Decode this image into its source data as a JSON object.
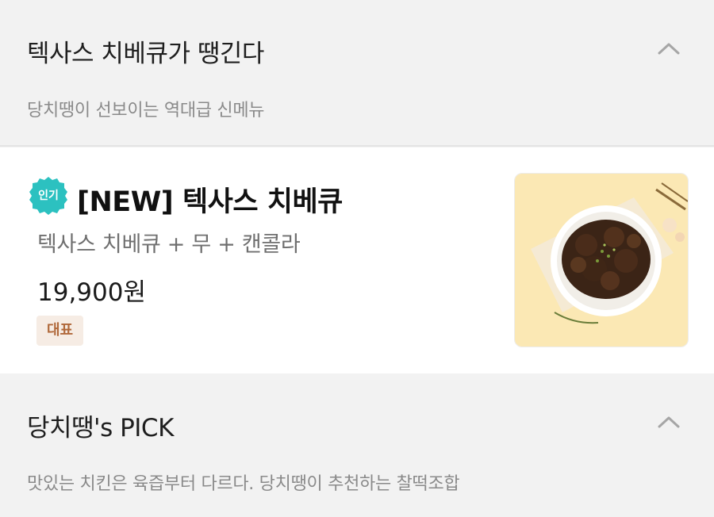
{
  "section1": {
    "title": "텍사스 치베큐가 땡긴다",
    "subtitle": "당치땡이 선보이는 역대급 신메뉴",
    "toggle_icon": "chevron-up-icon"
  },
  "menu_item": {
    "badge_label": "인기",
    "badge_color": "#2cc1c0",
    "name": "[NEW] 텍사스 치베큐",
    "description": "텍사스 치베큐 + 무 + 캔콜라",
    "price": "19,900원",
    "tag_label": "대표",
    "image_icon": "food-photo"
  },
  "section2": {
    "title": "당치땡's PICK",
    "subtitle": "맛있는 치킨은 육즙부터 다르다. 당치땡이 추천하는 찰떡조합",
    "toggle_icon": "chevron-up-icon"
  },
  "colors": {
    "background": "#f2f2f2",
    "card": "#ffffff",
    "badge": "#2cc1c0",
    "tag_bg": "#f6ece4",
    "tag_text": "#b0683a"
  }
}
